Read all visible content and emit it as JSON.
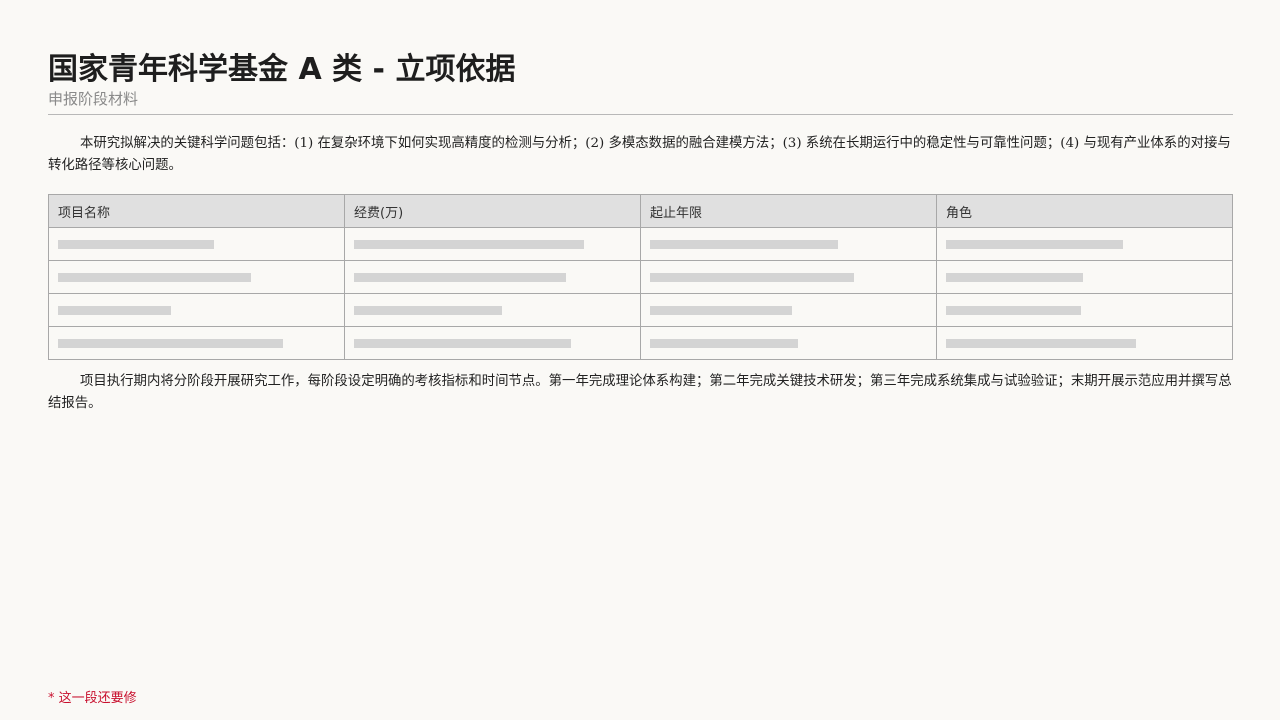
{
  "header": {
    "title": "国家青年科学基金 A 类 - 立项依据",
    "subtitle": "申报阶段材料"
  },
  "paragraphs": [
    "本研究拟解决的关键科学问题包括：(1) 在复杂环境下如何实现高精度的检测与分析；(2) 多模态数据的融合建模方法；(3) 系统在长期运行中的稳定性与可靠性问题；(4) 与现有产业体系的对接与转化路径等核心问题。",
    "项目执行期内将分阶段开展研究工作，每阶段设定明确的考核指标和时间节点。第一年完成理论体系构建；第二年完成关键技术研发；第三年完成系统集成与试验验证；末期开展示范应用并撰写总结报告。"
  ],
  "table": {
    "columns": [
      "项目名称",
      "经费(万)",
      "起止年限",
      "角色"
    ],
    "rows": [
      {
        "placeholder": true
      },
      {
        "placeholder": true
      },
      {
        "placeholder": true
      },
      {
        "placeholder": true
      }
    ]
  },
  "footnote": "* 这一段还要修",
  "colors": {
    "background": "#faf9f6",
    "header_fill": "#e0e0e0",
    "placeholder_bar": "#d4d4d4",
    "footnote": "#c8102e"
  }
}
